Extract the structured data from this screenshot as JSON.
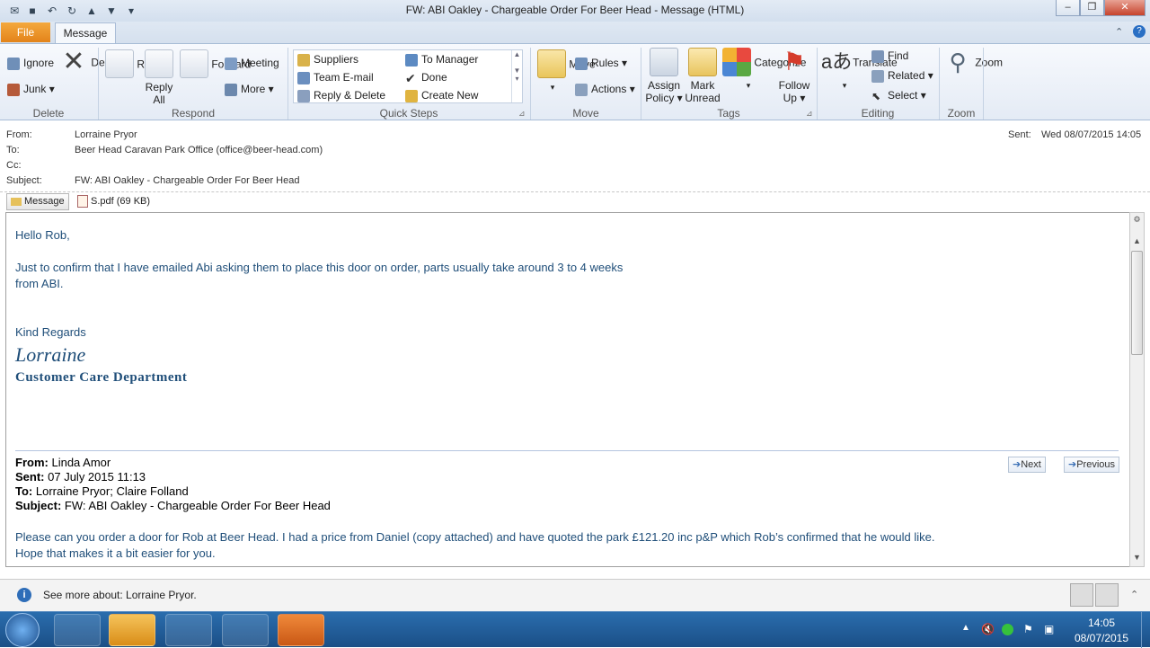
{
  "window": {
    "title": "FW: ABI Oakley - Chargeable Order For Beer Head  -  Message (HTML)"
  },
  "tabs": {
    "file": "File",
    "message": "Message"
  },
  "ribbon": {
    "delete_group": {
      "label": "Delete",
      "ignore": "Ignore",
      "junk": "Junk",
      "delete": "Delete"
    },
    "respond_group": {
      "label": "Respond",
      "reply": "Reply",
      "reply_all_1": "Reply",
      "reply_all_2": "All",
      "forward": "Forward",
      "meeting": "Meeting",
      "more": "More"
    },
    "quicksteps_group": {
      "label": "Quick Steps",
      "items": [
        "Suppliers",
        "Team E-mail",
        "Reply & Delete",
        "To Manager",
        "Done",
        "Create New"
      ]
    },
    "move_group": {
      "label": "Move",
      "move": "Move",
      "rules": "Rules",
      "actions": "Actions"
    },
    "tags_group": {
      "label": "Tags",
      "assign_1": "Assign",
      "assign_2": "Policy",
      "mark_1": "Mark",
      "mark_2": "Unread",
      "categorize": "Categorize",
      "follow_1": "Follow",
      "follow_2": "Up"
    },
    "editing_group": {
      "label": "Editing",
      "translate": "Translate",
      "find": "Find",
      "related": "Related",
      "select": "Select"
    },
    "zoom_group": {
      "label": "Zoom",
      "zoom": "Zoom"
    }
  },
  "header": {
    "from_label": "From:",
    "from_value": "Lorraine Pryor",
    "to_label": "To:",
    "to_value": "Beer Head Caravan Park Office (office@beer-head.com)",
    "cc_label": "Cc:",
    "subject_label": "Subject:",
    "subject_value": "FW: ABI Oakley - Chargeable Order For Beer Head",
    "sent_label": "Sent:",
    "sent_value": "Wed 08/07/2015 14:05"
  },
  "attachments": {
    "message_tab": "Message",
    "file": "S.pdf (69 KB)"
  },
  "body": {
    "greeting": "Hello Rob,",
    "line1": "Just to confirm that I have emailed Abi asking them to place this door on order, parts usually take around 3 to 4 weeks",
    "line2": "from ABI.",
    "regards": "Kind Regards",
    "signature_name": "Lorraine",
    "signature_dept": "Customer Care Department",
    "next": "Next",
    "previous": "Previous",
    "fwd_from_label": "From:",
    "fwd_from": "Linda Amor",
    "fwd_sent_label": "Sent:",
    "fwd_sent": "07 July 2015 11:13",
    "fwd_to_label": "To:",
    "fwd_to": "Lorraine Pryor; Claire Folland",
    "fwd_subject_label": "Subject:",
    "fwd_subject": "FW: ABI Oakley - Chargeable Order For Beer Head",
    "fwd_line1": "Please can you order a door for Rob at Beer Head.  I had a price from Daniel (copy attached) and have quoted the park £121.20 inc p&P which Rob’s confirmed that he would like.",
    "fwd_line2": "Hope that makes it a bit easier for you."
  },
  "people_pane": {
    "text": "See more about: Lorraine Pryor."
  },
  "taskbar": {
    "time": "14:05",
    "date": "08/07/2015"
  }
}
